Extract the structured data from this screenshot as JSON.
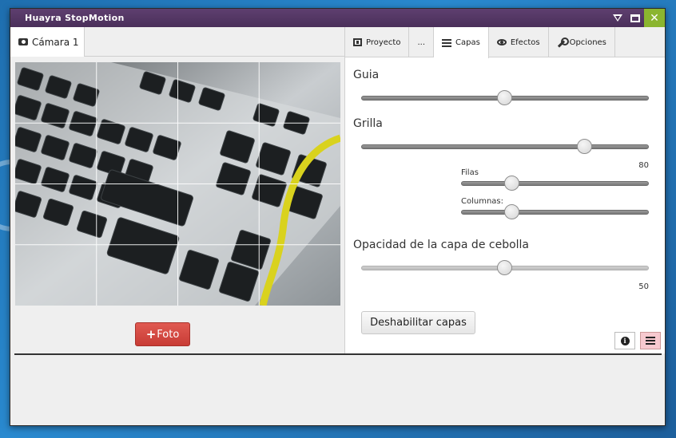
{
  "window": {
    "title": "Huayra StopMotion"
  },
  "camera_tab": {
    "label": "Cámara 1"
  },
  "foto_button": {
    "plus": "+",
    "label": "Foto"
  },
  "tabs": [
    {
      "label": "Proyecto",
      "icon": "film-icon"
    },
    {
      "label": "...",
      "icon": ""
    },
    {
      "label": "Capas",
      "icon": "bars-icon",
      "active": true
    },
    {
      "label": "Efectos",
      "icon": "eye-icon"
    },
    {
      "label": "Opciones",
      "icon": "wrench-icon"
    }
  ],
  "capas": {
    "guia": {
      "label": "Guia",
      "level": 0.5
    },
    "grilla": {
      "label": "Grilla",
      "level": 0.78,
      "value": "80"
    },
    "filas": {
      "label": "Filas",
      "level": 0.27
    },
    "columnas": {
      "label": "Columnas:",
      "level": 0.27
    },
    "opacidad": {
      "label": "Opacidad de la capa de cebolla",
      "level": 0.5,
      "value": "50"
    },
    "disable_button": "Deshabilitar capas"
  },
  "colors": {
    "titlebar": "#4a2f5a",
    "close": "#8bb52f",
    "foto": "#d2463f"
  }
}
